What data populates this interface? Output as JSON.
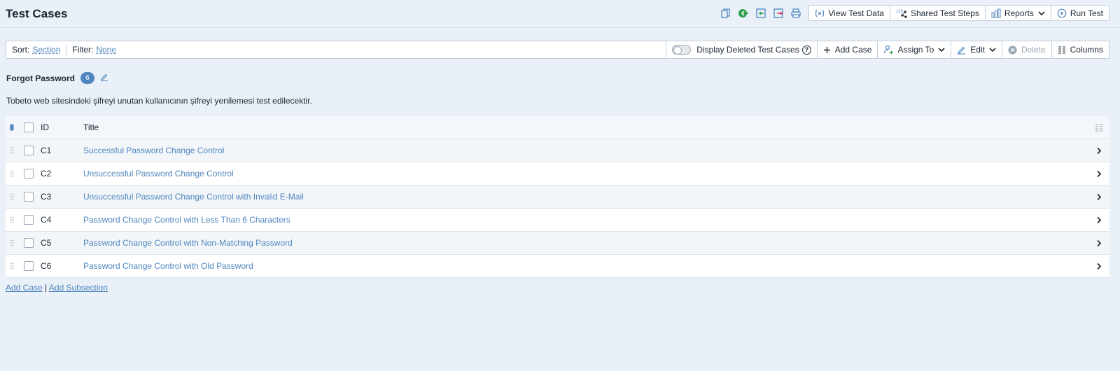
{
  "header": {
    "title": "Test Cases",
    "icons": [
      "copy-icon",
      "move-green-icon",
      "import-icon",
      "export-icon",
      "print-icon"
    ],
    "buttons": {
      "view_test_data": "View Test Data",
      "shared_test_steps": "Shared Test Steps",
      "reports": "Reports",
      "run_test": "Run Test"
    }
  },
  "toolbar": {
    "sort_label": "Sort:",
    "sort_value": "Section",
    "filter_label": "Filter:",
    "filter_value": "None",
    "display_deleted": "Display Deleted Test Cases",
    "help": "?",
    "add_case": "Add Case",
    "assign_to": "Assign To",
    "edit": "Edit",
    "delete": "Delete",
    "columns": "Columns"
  },
  "section": {
    "title": "Forgot Password",
    "count": "6",
    "description": "Tobeto web sitesindeki şifreyi unutan kullanıcının şifreyi yenilemesi test edilecektir."
  },
  "table": {
    "columns": {
      "id": "ID",
      "title": "Title"
    },
    "rows": [
      {
        "id": "C1",
        "title": "Successful Password Change Control"
      },
      {
        "id": "C2",
        "title": "Unsuccessful Password Change Control"
      },
      {
        "id": "C3",
        "title": "Unsuccessful Password Change Control with Invalid E-Mail"
      },
      {
        "id": "C4",
        "title": "Password Change Control with Less Than 6 Characters"
      },
      {
        "id": "C5",
        "title": "Password Change Control with Non-Matching Password"
      },
      {
        "id": "C6",
        "title": "Password Change Control with Old Password"
      }
    ]
  },
  "footer": {
    "add_case": "Add Case",
    "separator": "|",
    "add_subsection": "Add Subsection"
  },
  "colors": {
    "background": "#e9f0f7",
    "link": "#4f86bf",
    "badge": "#4f86bf",
    "text": "#1c2733"
  }
}
